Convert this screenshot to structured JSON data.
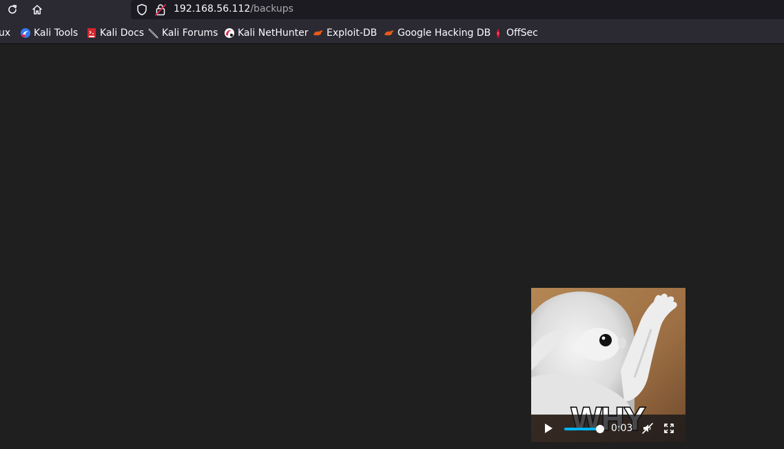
{
  "browser": {
    "url_host": "192.168.56.112",
    "url_path": "/backups"
  },
  "bookmarks": [
    {
      "label": "ux",
      "icon": "kali-dragon-icon"
    },
    {
      "label": "Kali Tools",
      "icon": "kali-tools-icon"
    },
    {
      "label": "Kali Docs",
      "icon": "kali-docs-icon"
    },
    {
      "label": "Kali Forums",
      "icon": "kali-forums-icon"
    },
    {
      "label": "Kali NetHunter",
      "icon": "kali-nethunter-icon"
    },
    {
      "label": "Exploit-DB",
      "icon": "exploit-db-icon"
    },
    {
      "label": "Google Hacking DB",
      "icon": "google-hacking-db-icon"
    },
    {
      "label": "OffSec",
      "icon": "offsec-icon"
    }
  ],
  "video": {
    "caption": "WHY",
    "time": "0:03",
    "progress": 0.92,
    "muted": true,
    "accent_color": "#00b3f4"
  }
}
